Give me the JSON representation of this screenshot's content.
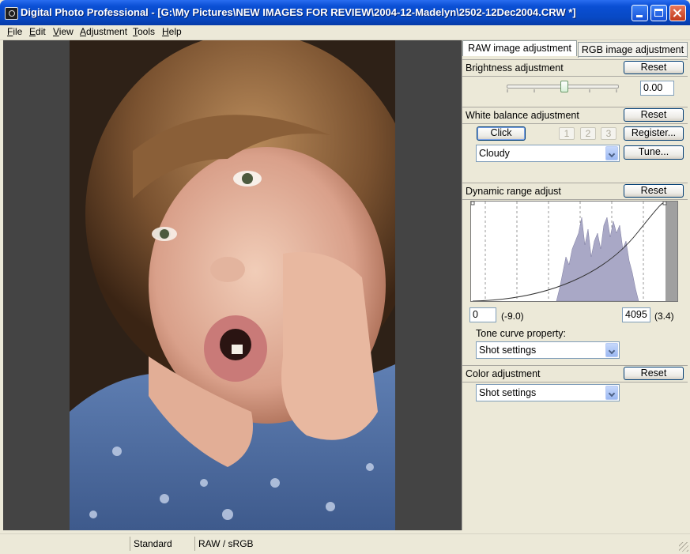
{
  "window": {
    "title": "Digital Photo Professional - [G:\\My Pictures\\NEW IMAGES FOR REVIEW\\2004-12-Madelyn\\2502-12Dec2004.CRW *]"
  },
  "menu": [
    "File",
    "Edit",
    "View",
    "Adjustment",
    "Tools",
    "Help"
  ],
  "tabs": {
    "raw": "RAW image adjustment",
    "rgb": "RGB image adjustment"
  },
  "brightness": {
    "label": "Brightness adjustment",
    "reset": "Reset",
    "value": "0.00",
    "slider_level": 0.5
  },
  "white_balance": {
    "label": "White balance adjustment",
    "reset": "Reset",
    "click": "Click",
    "presets": [
      "1",
      "2",
      "3"
    ],
    "register": "Register...",
    "tune": "Tune...",
    "mode": "Cloudy"
  },
  "dynamic_range": {
    "label": "Dynamic range adjust",
    "reset": "Reset",
    "low_value": "0",
    "low_ev": "(-9.0)",
    "high_value": "4095",
    "high_ev": "(3.4)",
    "tone_curve_label": "Tone curve property:",
    "tone_curve_value": "Shot settings"
  },
  "color": {
    "label": "Color adjustment",
    "reset": "Reset",
    "value": "Shot settings"
  },
  "status": {
    "picture_style": "Standard",
    "color_space": "RAW / sRGB"
  },
  "colors": {
    "titlebar": "#0a4fd4",
    "viewer_bg": "#444444",
    "histogram_fill": "#a9a8c6"
  }
}
